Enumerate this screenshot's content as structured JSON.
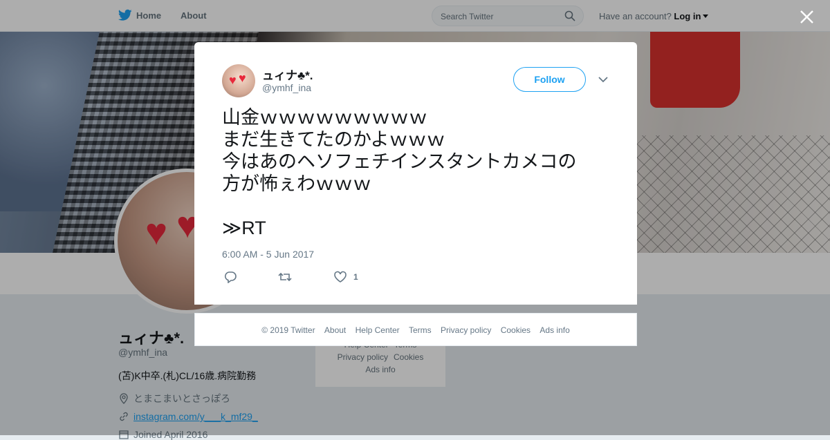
{
  "topbar": {
    "home_label": "Home",
    "about_label": "About",
    "search_placeholder": "Search Twitter",
    "have_account": "Have an account?",
    "login_label": "Log in"
  },
  "profile": {
    "name": "ュィナ♣*.",
    "handle": "@ymhf_ina",
    "bio": "(苫)K中卒.(札)CL/16歳.病院勤務",
    "location": "とまこまいとさっぽろ",
    "website": "instagram.com/y___k_mf29_",
    "joined": "Joined April 2016"
  },
  "side_footer": {
    "items": [
      "Help Center",
      "Terms",
      "Privacy policy",
      "Cookies",
      "Ads info"
    ]
  },
  "tweet": {
    "author_name": "ュィナ♣*.",
    "author_handle": "@ymhf_ina",
    "follow_label": "Follow",
    "text": "山金ｗｗｗｗｗｗｗｗｗ\nまだ生きてたのかよｗｗｗ\n今はあのヘソフェチインスタントカメコの\n方が怖ぇわｗｗｗ\n\n≫RT",
    "timestamp": "6:00 AM - 5 Jun 2017",
    "like_count": "1"
  },
  "footer": {
    "copyright": "© 2019 Twitter",
    "about": "About",
    "help_center": "Help Center",
    "terms": "Terms",
    "privacy": "Privacy policy",
    "cookies": "Cookies",
    "ads_info": "Ads info"
  },
  "colors": {
    "accent": "#1da1f2",
    "overlay": "rgba(0,0,0,0.32)",
    "heart_red": "#e8283b"
  },
  "icons": {
    "logo": "twitter-bird-icon",
    "search": "search-icon",
    "close": "close-icon",
    "chevron": "chevron-down-icon",
    "reply": "reply-icon",
    "retweet": "retweet-icon",
    "like": "heart-icon",
    "location": "location-pin-icon",
    "link": "link-icon",
    "calendar": "calendar-icon"
  }
}
